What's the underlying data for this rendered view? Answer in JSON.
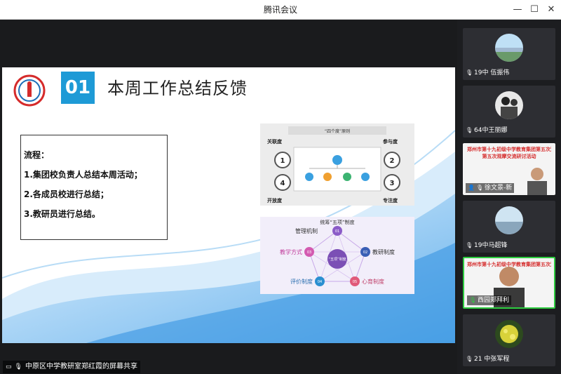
{
  "window": {
    "title": "腾讯会议"
  },
  "share": {
    "label": "中原区中学教研室郑红霞的屏幕共享"
  },
  "slide": {
    "number": "01",
    "title": "本周工作总结反馈",
    "process": {
      "heading": "流程：",
      "steps": [
        "1.集团校负责人总结本周活动；",
        "2.各成员校进行总结；",
        "3.教研员进行总结。"
      ]
    },
    "figure1": {
      "header": "“四个度”原则",
      "left_top": "关联度",
      "right_top": "参与度",
      "left_bottom": "开放度",
      "right_bottom": "专注度",
      "nums": [
        "1",
        "2",
        "3",
        "4"
      ]
    },
    "figure2": {
      "header": "统筹“五项”制度",
      "center": "“五项”制度",
      "items": [
        {
          "label": "管理机制",
          "num": "01"
        },
        {
          "label": "教研制度",
          "num": "02"
        },
        {
          "label": "教学方式",
          "num": "03"
        },
        {
          "label": "评价制度",
          "num": "04"
        },
        {
          "label": "心育制度",
          "num": "05"
        }
      ]
    }
  },
  "participants": [
    {
      "name": "19中 伍振伟"
    },
    {
      "name": "64中王丽娜"
    },
    {
      "name": "郑州市第十九初级中学教育集团第五次观摩交流研讨活动",
      "banner2": "第五次观摩交流研讨活动",
      "name2": "徐文景-新"
    },
    {
      "name": "19中马超锋"
    },
    {
      "name": "郑州市第十九初级中学教育集团第五次观摩交流研讨活动",
      "name2": "西园郑拜利"
    },
    {
      "name": "21 中张军程"
    }
  ],
  "colors": {
    "accent": "#1e9ad6",
    "active": "#2ecc40"
  }
}
